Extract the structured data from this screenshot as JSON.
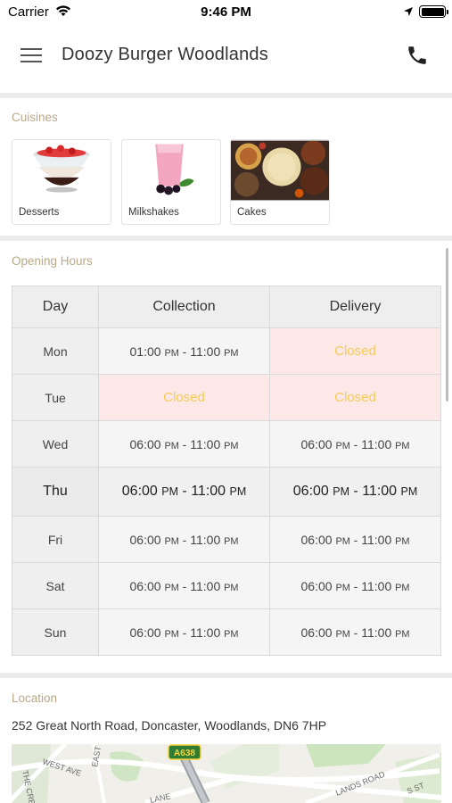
{
  "status_bar": {
    "carrier": "Carrier",
    "time": "9:46 PM"
  },
  "header": {
    "title": "Doozy Burger Woodlands",
    "menu_icon": "hamburger-menu-icon",
    "phone_icon": "phone-icon"
  },
  "cuisines": {
    "label": "Cuisines",
    "items": [
      {
        "label": "Desserts",
        "image": "dessert-bowl"
      },
      {
        "label": "Milkshakes",
        "image": "pink-milkshake"
      },
      {
        "label": "Cakes",
        "image": "food-platter"
      }
    ]
  },
  "opening_hours": {
    "label": "Opening Hours",
    "headers": [
      "Day",
      "Collection",
      "Delivery"
    ],
    "rows": [
      {
        "day": "Mon",
        "collection": {
          "closed": false,
          "from": "01:00",
          "to": "11:00"
        },
        "delivery": {
          "closed": true,
          "text": "Closed"
        }
      },
      {
        "day": "Tue",
        "collection": {
          "closed": true,
          "text": "Closed"
        },
        "delivery": {
          "closed": true,
          "text": "Closed"
        }
      },
      {
        "day": "Wed",
        "collection": {
          "closed": false,
          "from": "06:00",
          "to": "11:00"
        },
        "delivery": {
          "closed": false,
          "from": "06:00",
          "to": "11:00"
        }
      },
      {
        "day": "Thu",
        "today": true,
        "collection": {
          "closed": false,
          "from": "06:00",
          "to": "11:00"
        },
        "delivery": {
          "closed": false,
          "from": "06:00",
          "to": "11:00"
        }
      },
      {
        "day": "Fri",
        "collection": {
          "closed": false,
          "from": "06:00",
          "to": "11:00"
        },
        "delivery": {
          "closed": false,
          "from": "06:00",
          "to": "11:00"
        }
      },
      {
        "day": "Sat",
        "collection": {
          "closed": false,
          "from": "06:00",
          "to": "11:00"
        },
        "delivery": {
          "closed": false,
          "from": "06:00",
          "to": "11:00"
        }
      },
      {
        "day": "Sun",
        "collection": {
          "closed": false,
          "from": "06:00",
          "to": "11:00"
        },
        "delivery": {
          "closed": false,
          "from": "06:00",
          "to": "11:00"
        }
      }
    ],
    "period": "PM",
    "separator": " - "
  },
  "location": {
    "label": "Location",
    "address": "252 Great North Road, Doncaster, Woodlands, DN6 7HP",
    "map_labels": [
      "A638",
      "WEST AVE",
      "THE CRESC",
      "EAST",
      "LANDS ROAD",
      "S ST",
      "LANE"
    ]
  },
  "colors": {
    "section_label": "#b8a888",
    "closed_bg": "#fde8e8",
    "closed_text": "#f3cb55",
    "divider": "#ececec"
  }
}
